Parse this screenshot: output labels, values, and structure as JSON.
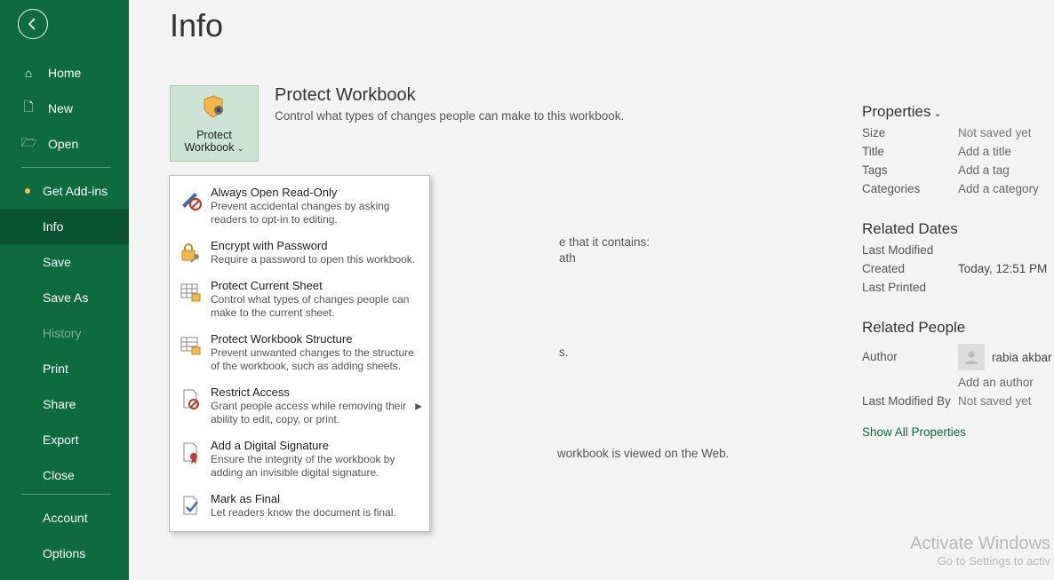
{
  "page_title": "Info",
  "sidebar": {
    "home": "Home",
    "new": "New",
    "open": "Open",
    "get_addins": "Get Add-ins",
    "info": "Info",
    "save": "Save",
    "save_as": "Save As",
    "history": "History",
    "print": "Print",
    "share": "Share",
    "export": "Export",
    "close": "Close",
    "account": "Account",
    "options": "Options"
  },
  "protect": {
    "button_line1": "Protect",
    "button_line2": "Workbook",
    "title": "Protect Workbook",
    "desc": "Control what types of changes people can make to this workbook."
  },
  "menu": {
    "readonly_t": "Always Open Read-Only",
    "readonly_d": "Prevent accidental changes by asking readers to opt-in to editing.",
    "encrypt_t": "Encrypt with Password",
    "encrypt_d": "Require a password to open this workbook.",
    "sheet_t": "Protect Current Sheet",
    "sheet_d": "Control what types of changes people can make to the current sheet.",
    "struct_t": "Protect Workbook Structure",
    "struct_d": "Prevent unwanted changes to the structure of the workbook, such as adding sheets.",
    "restrict_t": "Restrict Access",
    "restrict_d": "Grant people access while removing their ability to edit, copy, or print.",
    "sig_t": "Add a Digital Signature",
    "sig_d": "Ensure the integrity of the workbook by adding an invisible digital signature.",
    "final_t": "Mark as Final",
    "final_d": "Let readers know the document is final."
  },
  "behind": {
    "line1a": "e that it contains:",
    "line1b": "ath",
    "line2": "s.",
    "line3": "workbook is viewed on the Web."
  },
  "props": {
    "header": "Properties",
    "size_l": "Size",
    "size_v": "Not saved yet",
    "title_l": "Title",
    "title_v": "Add a title",
    "tags_l": "Tags",
    "tags_v": "Add a tag",
    "cat_l": "Categories",
    "cat_v": "Add a category",
    "dates_h": "Related Dates",
    "lastmod_l": "Last Modified",
    "lastmod_v": "",
    "created_l": "Created",
    "created_v": "Today, 12:51 PM",
    "printed_l": "Last Printed",
    "printed_v": "",
    "people_h": "Related People",
    "author_l": "Author",
    "author_v": "rabia akbar",
    "add_author": "Add an author",
    "modby_l": "Last Modified By",
    "modby_v": "Not saved yet",
    "show_all": "Show All Properties"
  },
  "watermark": {
    "l1": "Activate Windows",
    "l2": "Go to Settings to activ"
  }
}
